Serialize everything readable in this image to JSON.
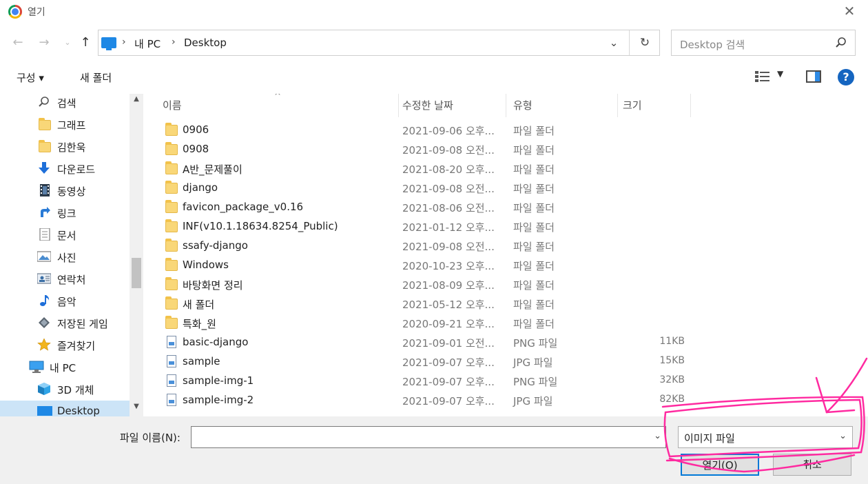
{
  "window": {
    "title": "열기"
  },
  "address": {
    "crumbs": [
      "내 PC",
      "Desktop"
    ],
    "search_placeholder": "Desktop 검색"
  },
  "toolbar": {
    "organize_label": "구성 ▾",
    "new_folder_label": "새 폴더"
  },
  "nav_pane": {
    "items": [
      {
        "label": "검색",
        "icon": "search-icon"
      },
      {
        "label": "그래프",
        "icon": "folder-icon"
      },
      {
        "label": "김한욱",
        "icon": "folder-icon"
      },
      {
        "label": "다운로드",
        "icon": "download-icon"
      },
      {
        "label": "동영상",
        "icon": "video-icon"
      },
      {
        "label": "링크",
        "icon": "link-icon"
      },
      {
        "label": "문서",
        "icon": "document-icon"
      },
      {
        "label": "사진",
        "icon": "picture-icon"
      },
      {
        "label": "연락처",
        "icon": "contacts-icon"
      },
      {
        "label": "음악",
        "icon": "music-icon"
      },
      {
        "label": "저장된 게임",
        "icon": "saved-games-icon"
      },
      {
        "label": "즐겨찾기",
        "icon": "favorites-icon"
      },
      {
        "label": "내 PC",
        "icon": "pc-icon"
      },
      {
        "label": "3D 개체",
        "icon": "3d-objects-icon"
      },
      {
        "label": "Desktop",
        "icon": "desktop-icon"
      }
    ]
  },
  "columns": {
    "name": "이름",
    "date": "수정한 날짜",
    "type": "유형",
    "size": "크기"
  },
  "files": [
    {
      "name": "0906",
      "date": "2021-09-06 오후...",
      "type": "파일 폴더",
      "size": "",
      "icon": "folder-icon"
    },
    {
      "name": "0908",
      "date": "2021-09-08 오전...",
      "type": "파일 폴더",
      "size": "",
      "icon": "folder-icon"
    },
    {
      "name": "A반_문제풀이",
      "date": "2021-08-20 오후...",
      "type": "파일 폴더",
      "size": "",
      "icon": "folder-icon"
    },
    {
      "name": "django",
      "date": "2021-09-08 오전...",
      "type": "파일 폴더",
      "size": "",
      "icon": "folder-icon"
    },
    {
      "name": "favicon_package_v0.16",
      "date": "2021-08-06 오전...",
      "type": "파일 폴더",
      "size": "",
      "icon": "folder-icon"
    },
    {
      "name": "INF(v10.1.18634.8254_Public)",
      "date": "2021-01-12 오후...",
      "type": "파일 폴더",
      "size": "",
      "icon": "folder-icon"
    },
    {
      "name": "ssafy-django",
      "date": "2021-09-08 오전...",
      "type": "파일 폴더",
      "size": "",
      "icon": "folder-icon"
    },
    {
      "name": "Windows",
      "date": "2020-10-23 오후...",
      "type": "파일 폴더",
      "size": "",
      "icon": "folder-icon"
    },
    {
      "name": "바탕화면 정리",
      "date": "2021-08-09 오후...",
      "type": "파일 폴더",
      "size": "",
      "icon": "folder-icon"
    },
    {
      "name": "새 폴더",
      "date": "2021-05-12 오후...",
      "type": "파일 폴더",
      "size": "",
      "icon": "folder-icon"
    },
    {
      "name": "특화_원",
      "date": "2020-09-21 오후...",
      "type": "파일 폴더",
      "size": "",
      "icon": "folder-icon"
    },
    {
      "name": "basic-django",
      "date": "2021-09-01 오전...",
      "type": "PNG 파일",
      "size": "11KB",
      "icon": "image-file-icon"
    },
    {
      "name": "sample",
      "date": "2021-09-07 오후...",
      "type": "JPG 파일",
      "size": "15KB",
      "icon": "image-file-icon"
    },
    {
      "name": "sample-img-1",
      "date": "2021-09-07 오후...",
      "type": "PNG 파일",
      "size": "32KB",
      "icon": "image-file-icon"
    },
    {
      "name": "sample-img-2",
      "date": "2021-09-07 오후...",
      "type": "JPG 파일",
      "size": "82KB",
      "icon": "image-file-icon"
    }
  ],
  "footer": {
    "filename_label": "파일 이름(N):",
    "filename_value": "",
    "filter_value": "이미지 파일",
    "open_label": "열기(O)",
    "cancel_label": "취소"
  },
  "colors": {
    "accent": "#0078d7",
    "annotation": "#ff2aa0",
    "folder": "#f9d778",
    "selection": "#cce4f7"
  }
}
